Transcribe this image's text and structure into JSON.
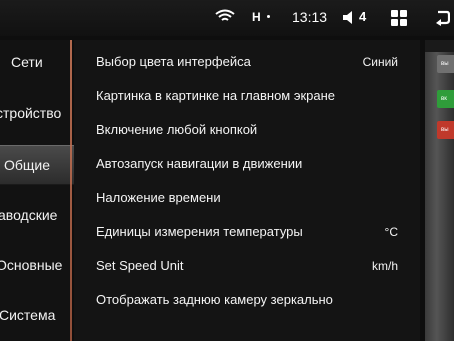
{
  "status_bar": {
    "network": "H",
    "time": "13:13",
    "volume": "4",
    "icons": [
      "wifi-icon",
      "volume-icon",
      "apps-grid-icon",
      "back-icon"
    ]
  },
  "sidebar": {
    "items": [
      {
        "label": "Сети"
      },
      {
        "label": "стройство"
      },
      {
        "label": "Общие",
        "active": true
      },
      {
        "label": "аводские"
      },
      {
        "label": "Основные"
      },
      {
        "label": "Система"
      }
    ]
  },
  "settings": {
    "rows": [
      {
        "label": "Выбор цвета интерфейса",
        "value": "Синий"
      },
      {
        "label": "Картинка в картинке на главном экране",
        "value": ""
      },
      {
        "label": "Включение любой кнопкой",
        "value": ""
      },
      {
        "label": "Автозапуск навигации в движении",
        "value": ""
      },
      {
        "label": "Наложение времени",
        "value": ""
      },
      {
        "label": "Единицы измерения температуры",
        "value": "°C"
      },
      {
        "label": "Set Speed Unit",
        "value": "km/h"
      },
      {
        "label": "Отображать заднюю камеру зеркально",
        "value": ""
      }
    ]
  },
  "side_panel": {
    "buttons": [
      {
        "label": "вы",
        "color": "#707070"
      },
      {
        "label": "вк",
        "color": "#2f9d3a"
      },
      {
        "label": "вы",
        "color": "#c0392b"
      }
    ]
  }
}
